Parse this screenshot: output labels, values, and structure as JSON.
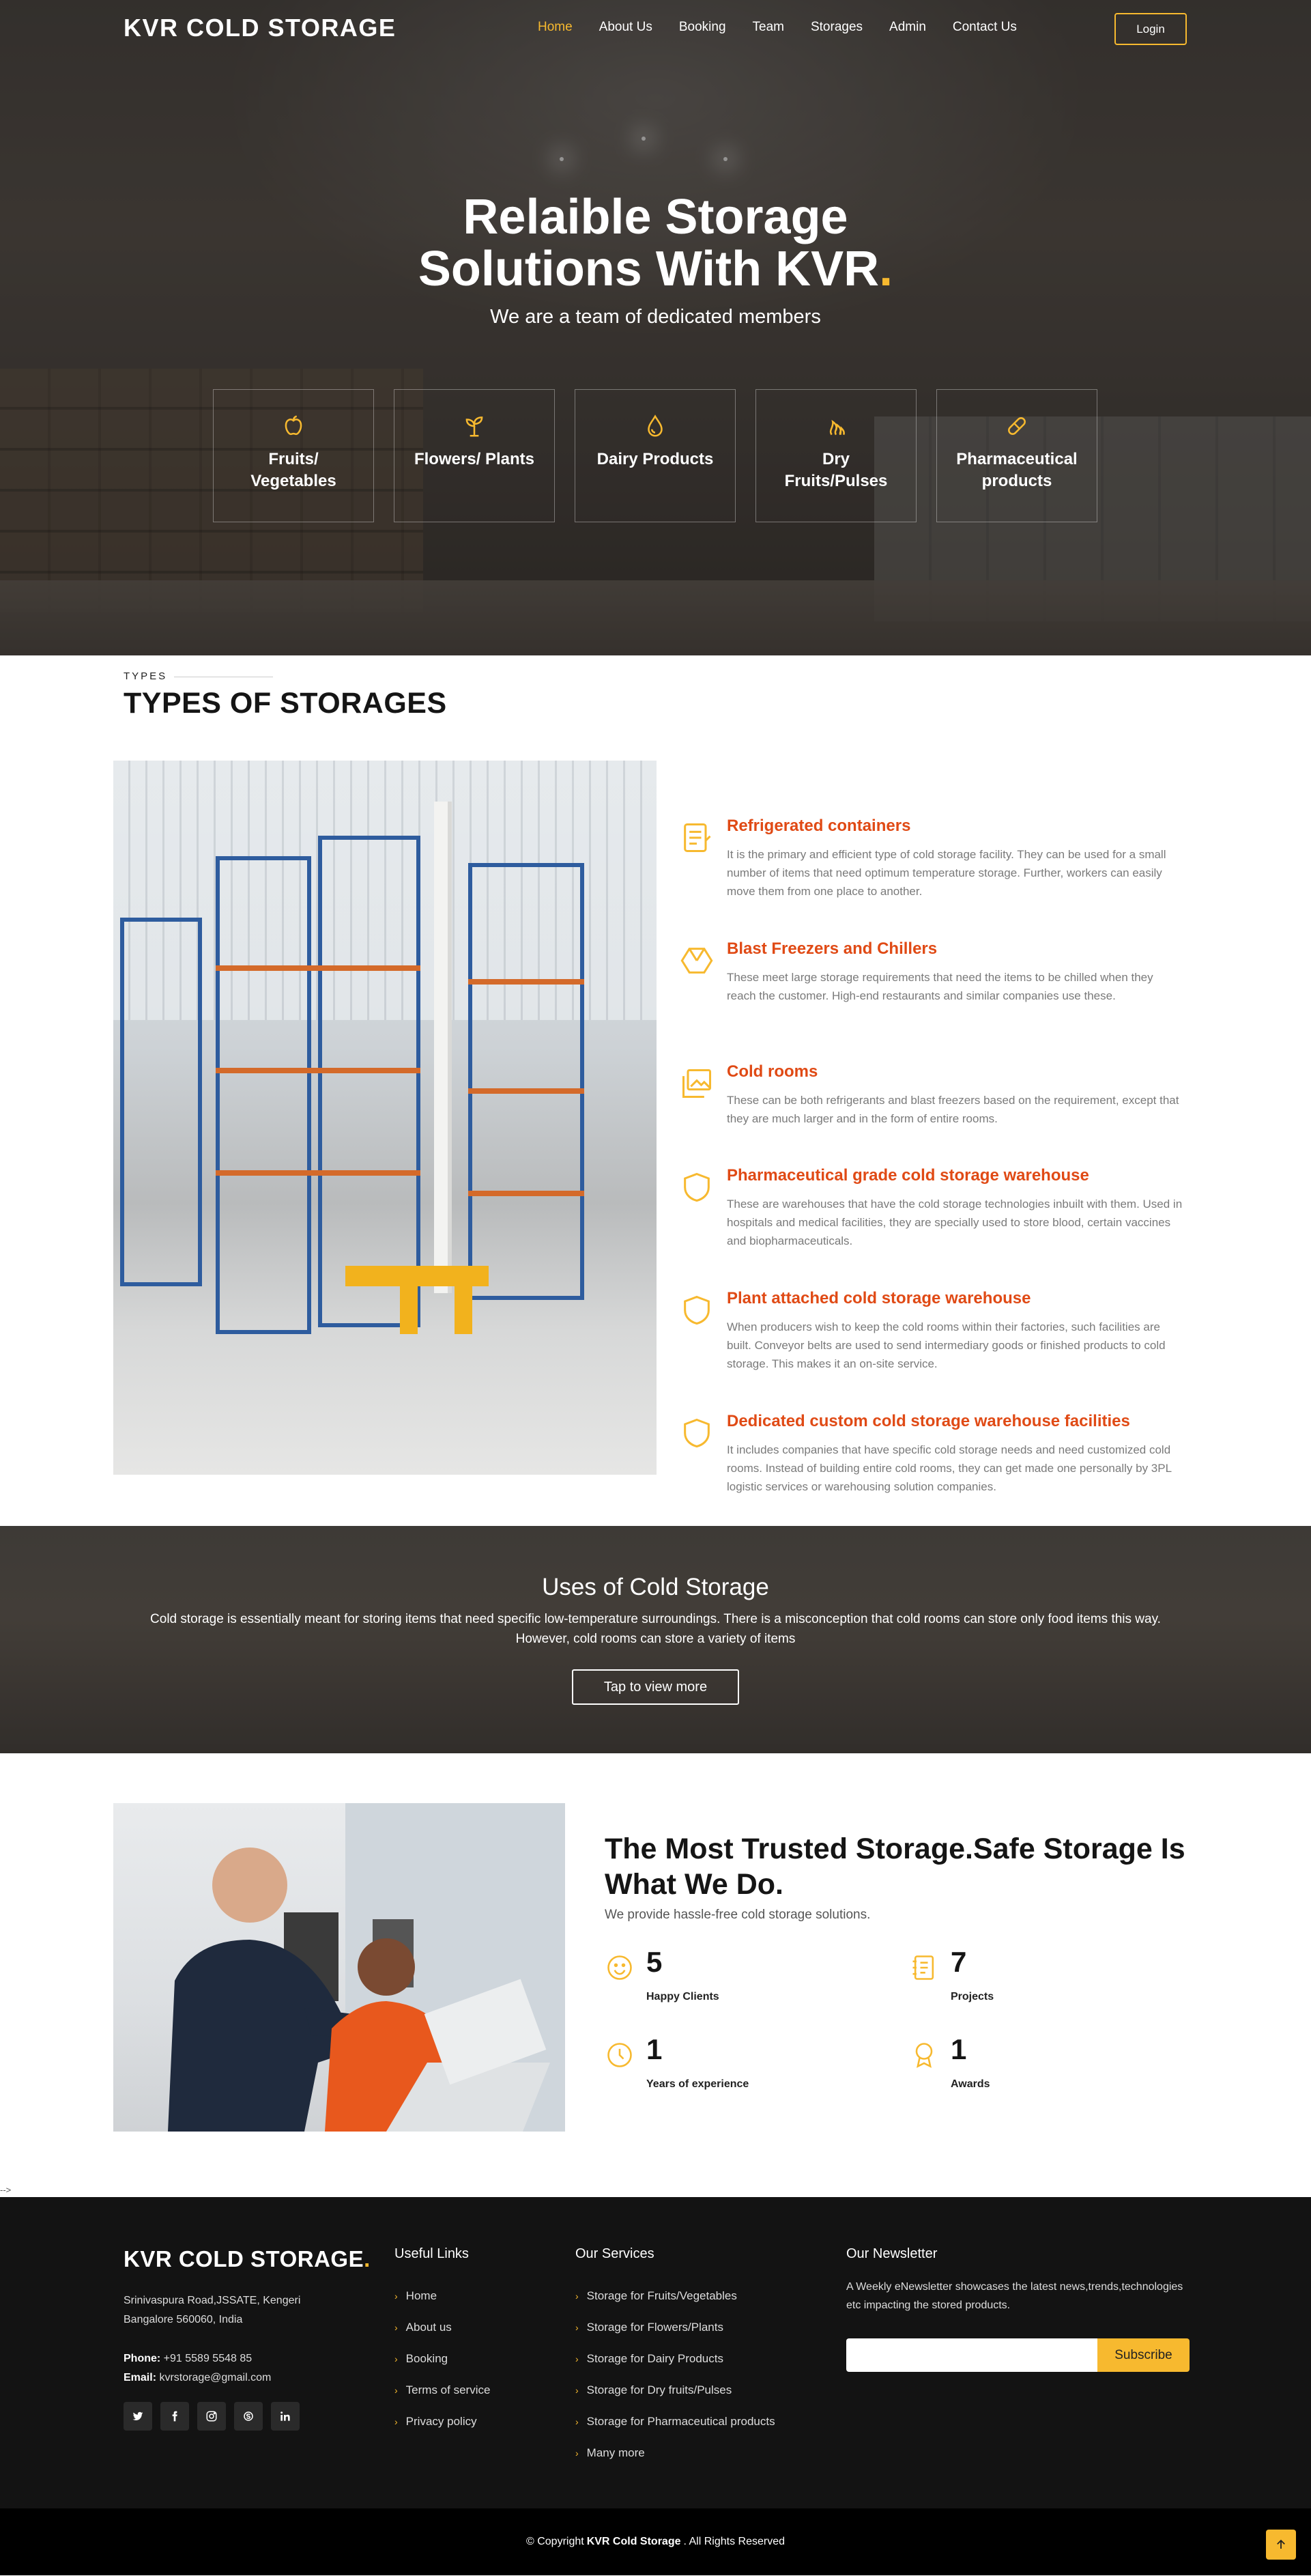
{
  "nav": {
    "brand": "KVR COLD STORAGE",
    "items": [
      {
        "label": "Home",
        "active": true
      },
      {
        "label": "About Us"
      },
      {
        "label": "Booking"
      },
      {
        "label": "Team"
      },
      {
        "label": "Storages"
      },
      {
        "label": "Admin"
      },
      {
        "label": "Contact Us"
      }
    ],
    "login": "Login"
  },
  "hero": {
    "title_line1": "Relaible Storage",
    "title_line2": "Solutions With KVR",
    "title_dot": ".",
    "subtitle": "We are a team of dedicated members",
    "categories": [
      {
        "label_line1": "Fruits/",
        "label_line2": "Vegetables",
        "icon": "apple-icon"
      },
      {
        "label_line1": "Flowers/ Plants",
        "label_line2": "",
        "icon": "sprout-icon"
      },
      {
        "label_line1": "Dairy Products",
        "label_line2": "",
        "icon": "drop-icon"
      },
      {
        "label_line1": "Dry",
        "label_line2": "Fruits/Pulses",
        "icon": "fire-icon"
      },
      {
        "label_line1": "Pharmaceutical",
        "label_line2": "products",
        "icon": "capsule-icon"
      }
    ]
  },
  "types": {
    "tag": "TYPES",
    "title": "TYPES OF STORAGES",
    "services": [
      {
        "title": "Refrigerated containers",
        "icon": "list-icon",
        "text": "It is the primary and efficient type of cold storage facility. They can be used for a small number of items that need optimum temperature storage. Further, workers can easily move them from one place to another."
      },
      {
        "title": "Blast Freezers and Chillers",
        "icon": "hexagon-icon",
        "text": "These meet large storage requirements that need the items to be chilled when they reach the customer. High-end restaurants and similar companies use these."
      },
      {
        "title": "Cold rooms",
        "icon": "images-icon",
        "text": "These can be both refrigerants and blast freezers based on the requirement, except that they are much larger and in the form of entire rooms."
      },
      {
        "title": "Pharmaceutical grade cold storage warehouse",
        "icon": "shield-icon",
        "text": "These are warehouses that have the cold storage technologies inbuilt with them. Used in hospitals and medical facilities, they are specially used to store blood, certain vaccines and biopharmaceuticals."
      },
      {
        "title": "Plant attached cold storage warehouse",
        "icon": "shield-icon",
        "text": "When producers wish to keep the cold rooms within their factories, such facilities are built. Conveyor belts are used to send intermediary goods or finished products to cold storage. This makes it an on-site service."
      },
      {
        "title": "Dedicated custom cold storage warehouse facilities",
        "icon": "shield-icon",
        "text": "It includes companies that have specific cold storage needs and need customized cold rooms. Instead of building entire cold rooms, they can get made one personally by 3PL logistic services or warehousing solution companies."
      }
    ]
  },
  "uses": {
    "title": "Uses of Cold Storage",
    "text": "Cold storage is essentially meant for storing items that need specific low-temperature surroundings. There is a misconception that cold rooms can store only food items this way. However, cold rooms can store a variety of items",
    "button": "Tap to view more"
  },
  "trusted": {
    "title": "The Most Trusted Storage.Safe Storage Is What We Do.",
    "subtitle": "We provide hassle-free cold storage solutions.",
    "stats": [
      {
        "num": "5",
        "caption": "Happy Clients",
        "icon": "smile-icon"
      },
      {
        "num": "7",
        "caption": "Projects",
        "icon": "journal-icon"
      },
      {
        "num": "1",
        "caption": "Years of experience",
        "icon": "clock-icon"
      },
      {
        "num": "1",
        "caption": "Awards",
        "icon": "award-icon"
      }
    ]
  },
  "stray_text": "-->",
  "footer": {
    "brand": "KVR COLD STORAGE",
    "brand_dot": ".",
    "address_line1": "Srinivaspura Road,JSSATE, Kengeri",
    "address_line2": "Bangalore 560060, India",
    "phone_label": "Phone:",
    "phone": "+91 5589 5548 85",
    "email_label": "Email:",
    "email": "kvrstorage@gmail.com",
    "socials": [
      "twitter-icon",
      "facebook-icon",
      "instagram-icon",
      "skype-icon",
      "linkedin-icon"
    ],
    "useful_links_title": "Useful Links",
    "useful_links": [
      "Home",
      "About us",
      "Booking",
      "Terms of service",
      "Privacy policy"
    ],
    "services_title": "Our Services",
    "services": [
      "Storage for Fruits/Vegetables",
      "Storage for Flowers/Plants",
      "Storage for Dairy Products",
      "Storage for Dry fruits/Pulses",
      "Storage for Pharmaceutical products",
      "Many more"
    ],
    "newsletter_title": "Our Newsletter",
    "newsletter_text": "A Weekly eNewsletter showcases the latest news,trends,technologies etc impacting the stored products.",
    "subscribe": "Subscribe"
  },
  "copyright": {
    "prefix": "© Copyright",
    "name": "KVR Cold Storage",
    "suffix": ". All Rights Reserved"
  },
  "colors": {
    "accent": "#f7b92f",
    "service_title": "#e04a15",
    "footer_bg": "#131313"
  }
}
